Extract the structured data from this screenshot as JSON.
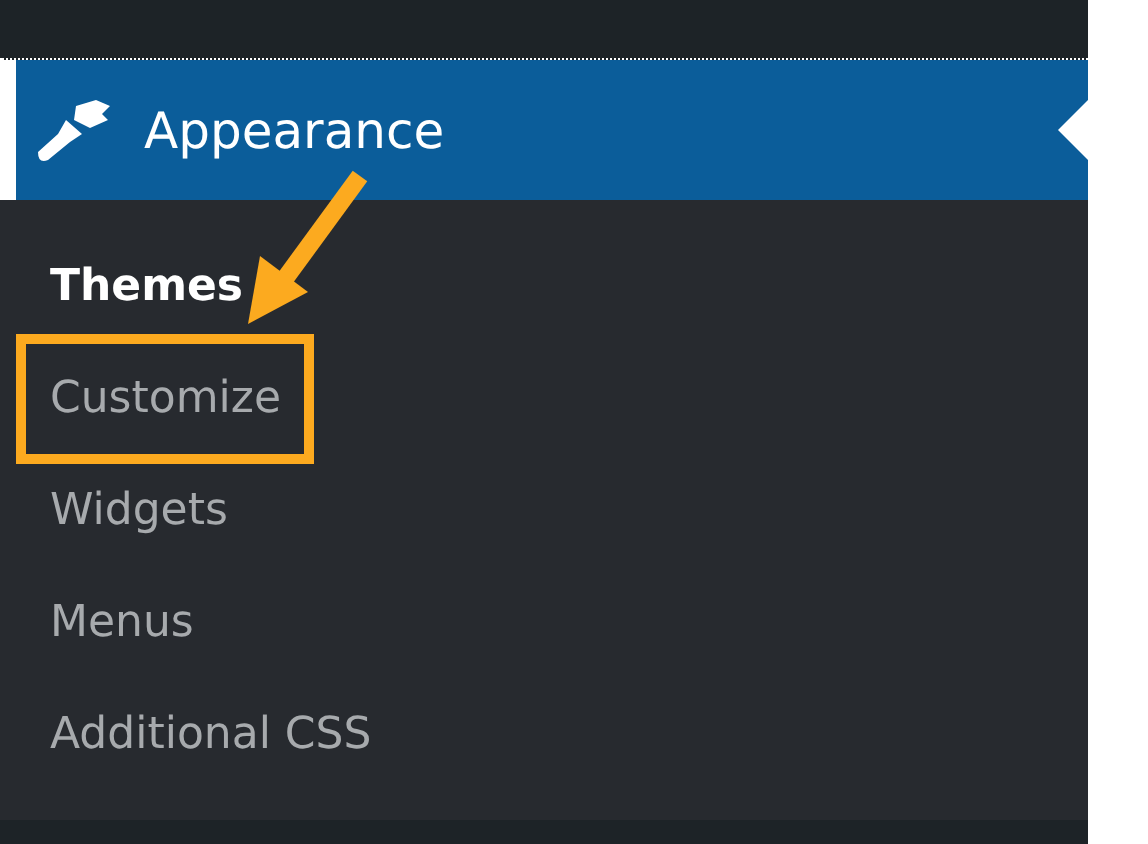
{
  "menu": {
    "label": "Appearance",
    "expanded": true
  },
  "submenu": [
    {
      "label": "Themes",
      "selected": true,
      "highlighted": false
    },
    {
      "label": "Customize",
      "selected": false,
      "highlighted": true
    },
    {
      "label": "Widgets",
      "selected": false,
      "highlighted": false
    },
    {
      "label": "Menus",
      "selected": false,
      "highlighted": false
    },
    {
      "label": "Additional CSS",
      "selected": false,
      "highlighted": false
    }
  ]
}
